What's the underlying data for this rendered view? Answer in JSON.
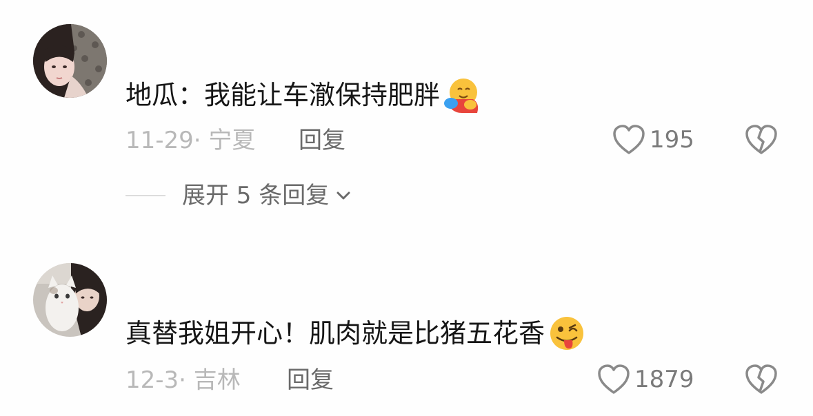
{
  "comments": [
    {
      "avatar_icon": "avatar-photo-woman-icon",
      "text": "地瓜：我能让车澈保持肥胖",
      "emoji": "hugging-face-emoji",
      "date": "11-29",
      "location": "宁夏",
      "reply_label": "回复",
      "like_count": "195",
      "expand_replies_label": "展开 5 条回复"
    },
    {
      "avatar_icon": "avatar-photo-woman-cat-icon",
      "text": "真替我姐开心！肌肉就是比猪五花香",
      "emoji": "winking-tongue-face-emoji",
      "date": "12-3",
      "location": "吉林",
      "reply_label": "回复",
      "like_count": "1879"
    }
  ],
  "colors": {
    "background": "#fefefe",
    "text": "#161616",
    "meta": "#b8b8b8",
    "action": "#6a6a6a"
  },
  "icons": {
    "like": "heart-outline-icon",
    "dislike": "broken-heart-icon",
    "expand": "chevron-down-icon"
  }
}
